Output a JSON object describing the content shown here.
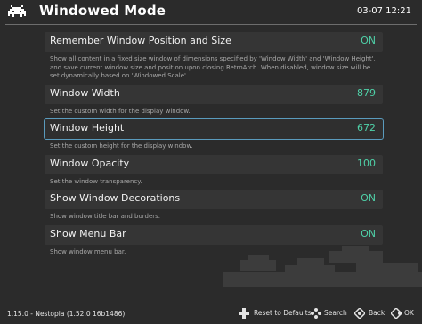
{
  "header": {
    "title": "Windowed Mode",
    "clock": "03-07 12:21"
  },
  "settings": [
    {
      "label": "Remember Window Position and Size",
      "value": "ON",
      "description": "Show all content in a fixed size window of dimensions specified by 'Window Width' and 'Window Height', and save current window size and position upon closing RetroArch. When disabled, window size will be set dynamically based on 'Windowed Scale'."
    },
    {
      "label": "Window Width",
      "value": "879",
      "description": "Set the custom width for the display window."
    },
    {
      "label": "Window Height",
      "value": "672",
      "description": "Set the custom height for the display window."
    },
    {
      "label": "Window Opacity",
      "value": "100",
      "description": "Set the window transparency."
    },
    {
      "label": "Show Window Decorations",
      "value": "ON",
      "description": "Show window title bar and borders."
    },
    {
      "label": "Show Menu Bar",
      "value": "ON",
      "description": "Show window menu bar."
    }
  ],
  "selected_index": 2,
  "footer": {
    "version": "1.15.0 - Nestopia (1.52.0 16b1486)",
    "reset": "Reset to Defaults",
    "search": "Search",
    "back": "Back",
    "ok": "OK"
  },
  "colors": {
    "accent": "#4fd1a8",
    "selection": "#5a9bbd",
    "background": "#2b2b2b"
  }
}
